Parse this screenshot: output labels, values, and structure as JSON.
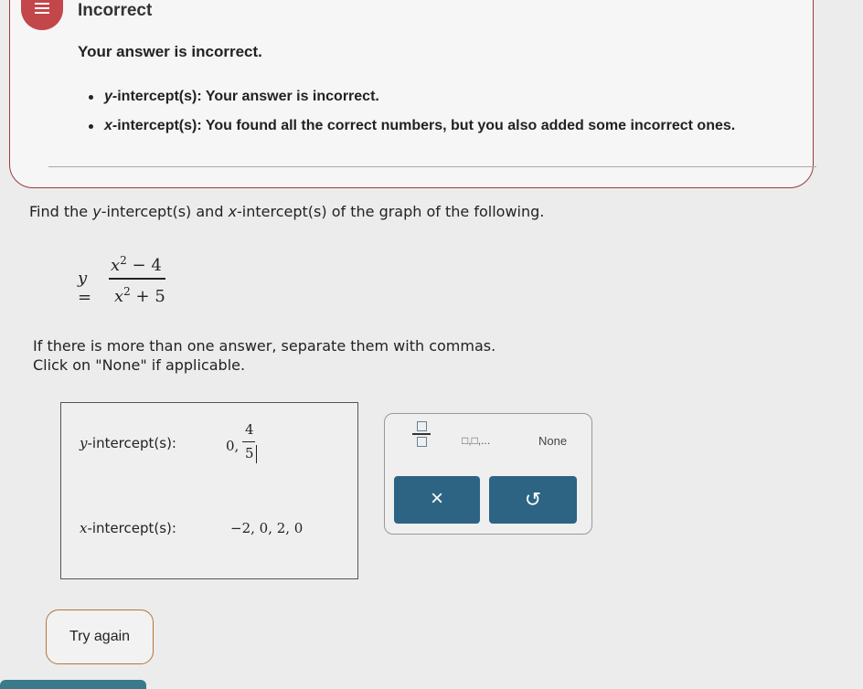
{
  "feedback": {
    "title": "Incorrect",
    "summary": "Your answer is incorrect.",
    "items": [
      {
        "var": "y",
        "label": "-intercept(s): ",
        "message": "Your answer is incorrect."
      },
      {
        "var": "x",
        "label": "-intercept(s): ",
        "message": "You found all the correct numbers, but you also added some incorrect ones."
      }
    ]
  },
  "question": {
    "prefix": "Find the ",
    "var1": "y",
    "middle": "-intercept(s) and ",
    "var2": "x",
    "suffix": "-intercept(s) of the graph of the following."
  },
  "equation": {
    "lhs": "y",
    "equals": "=",
    "numerator": "x² − 4",
    "numerator_base": "x",
    "numerator_exp": "2",
    "numerator_rest": " − 4",
    "denominator_base": "x",
    "denominator_exp": "2",
    "denominator_rest": " + 5"
  },
  "instructions": {
    "line1": "If there is more than one answer, separate them with commas.",
    "line2": "Click on \"None\" if applicable."
  },
  "answers": {
    "y_var": "y",
    "y_label": "-intercept(s):",
    "y_value_zero": "0,",
    "y_value_num": "4",
    "y_value_den": "5",
    "x_var": "x",
    "x_label": "-intercept(s):",
    "x_value": "−2, 0, 2, 0"
  },
  "toolbar": {
    "list_label": "□,□,...",
    "none_label": "None",
    "clear_symbol": "×",
    "undo_symbol": "↺"
  },
  "actions": {
    "try_again_label": "Try again"
  },
  "colors": {
    "error_red": "#c2464a",
    "button_blue": "#2d6484",
    "try_again_border": "#b5743a"
  }
}
